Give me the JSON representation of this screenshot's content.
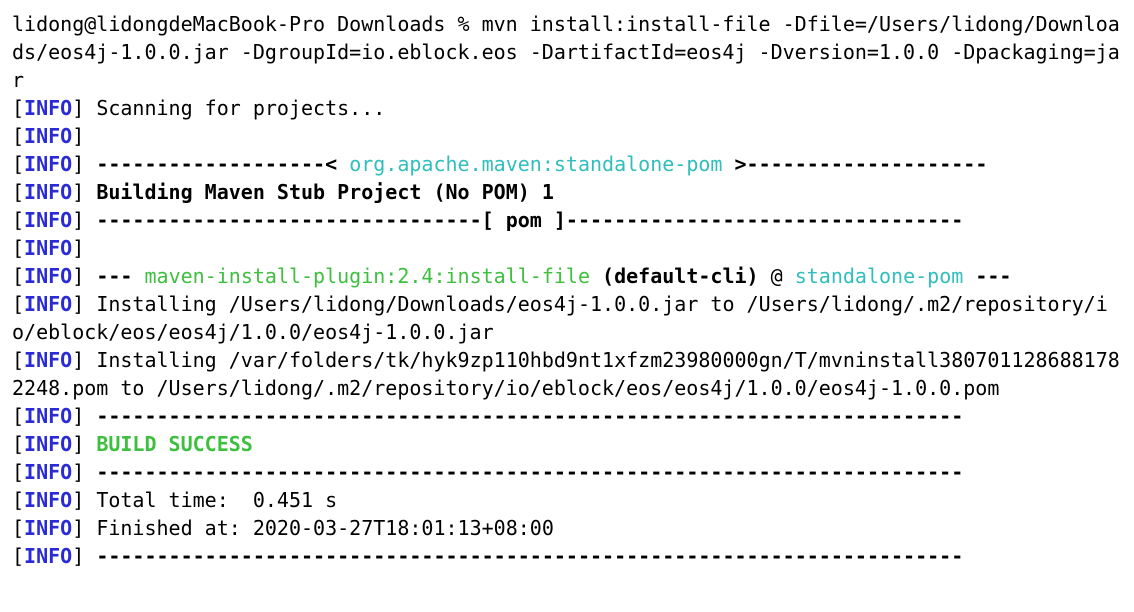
{
  "command_line": "lidong@lidongdeMacBook-Pro Downloads % mvn install:install-file -Dfile=/Users/lidong/Downloads/eos4j-1.0.0.jar -DgroupId=io.eblock.eos -DartifactId=eos4j -Dversion=1.0.0 -Dpackaging=jar",
  "info_tag": "INFO",
  "msg_scanning": "Scanning for projects...",
  "hdr1_left": "-------------------< ",
  "hdr1_art": "org.apache.maven:standalone-pom",
  "hdr1_right": " >--------------------",
  "hdr_build": "Building Maven Stub Project (No POM) 1",
  "hdr2": "--------------------------------[ pom ]---------------------------------",
  "plug_pre": "--- ",
  "plug_id": "maven-install-plugin:2.4:install-file",
  "plug_mid": " (default-cli)",
  "plug_at": " @ ",
  "plug_proj": "standalone-pom",
  "plug_post": " ---",
  "msg_install1": "Installing /Users/lidong/Downloads/eos4j-1.0.0.jar to /Users/lidong/.m2/repository/io/eblock/eos/eos4j/1.0.0/eos4j-1.0.0.jar",
  "msg_install2": "Installing /var/folders/tk/hyk9zp110hbd9nt1xfzm23980000gn/T/mvninstall3807011286881782248.pom to /Users/lidong/.m2/repository/io/eblock/eos/eos4j/1.0.0/eos4j-1.0.0.pom",
  "rule": "------------------------------------------------------------------------",
  "build_success": "BUILD SUCCESS",
  "total_time": "Total time:  0.451 s",
  "finished_at": "Finished at: 2020-03-27T18:01:13+08:00"
}
